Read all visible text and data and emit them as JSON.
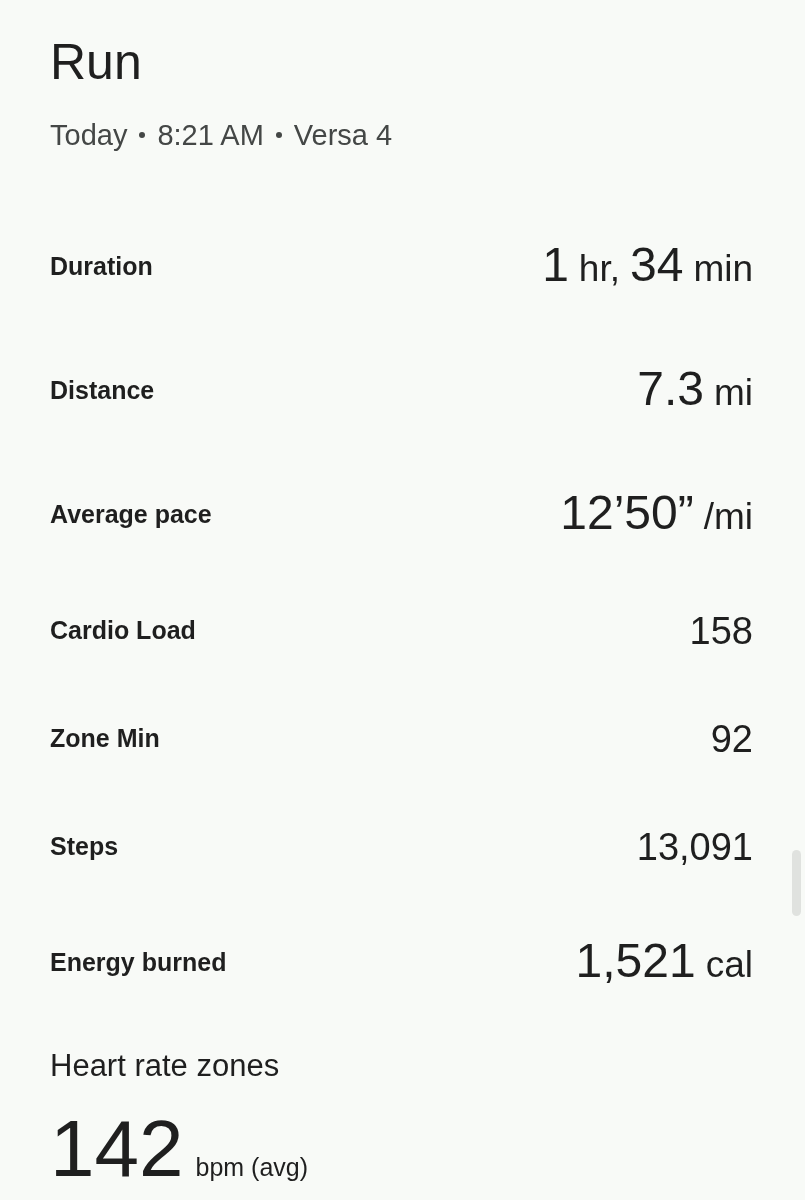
{
  "title": "Run",
  "subtitle": [
    "Today",
    "8:21 AM",
    "Versa 4"
  ],
  "stats": [
    {
      "label": "Duration",
      "value": [
        {
          "kind": "number",
          "text": "1"
        },
        {
          "kind": "unit",
          "text": "hr,"
        },
        {
          "kind": "number",
          "text": "34"
        },
        {
          "kind": "unit",
          "text": "min"
        }
      ]
    },
    {
      "label": "Distance",
      "value": [
        {
          "kind": "number",
          "text": "7.3"
        },
        {
          "kind": "unit",
          "text": "mi"
        }
      ]
    },
    {
      "label": "Average pace",
      "value": [
        {
          "kind": "number",
          "text": "12’50”"
        },
        {
          "kind": "unit",
          "text": "/mi"
        }
      ]
    },
    {
      "label": "Cardio Load",
      "value": [
        {
          "kind": "plain",
          "text": "158"
        }
      ]
    },
    {
      "label": "Zone Min",
      "value": [
        {
          "kind": "plain",
          "text": "92"
        }
      ]
    },
    {
      "label": "Steps",
      "value": [
        {
          "kind": "plain",
          "text": "13,091"
        }
      ]
    },
    {
      "label": "Energy burned",
      "value": [
        {
          "kind": "number",
          "text": "1,521"
        },
        {
          "kind": "unit",
          "text": "cal"
        }
      ]
    }
  ],
  "heart_rate": {
    "title": "Heart rate zones",
    "value": "142",
    "unit": "bpm (avg)"
  }
}
